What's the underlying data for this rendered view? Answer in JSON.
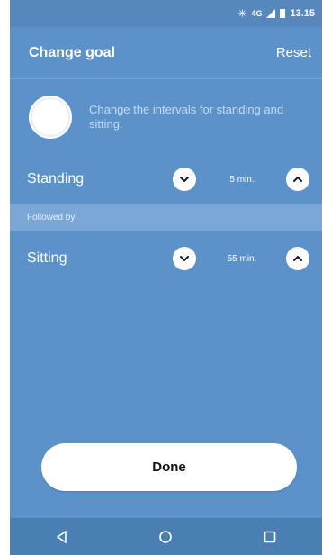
{
  "status_bar": {
    "bluetooth_icon": "bluetooth-icon",
    "network": "4G",
    "time": "13.15"
  },
  "header": {
    "title": "Change goal",
    "reset_label": "Reset"
  },
  "intro": {
    "text": "Change the intervals for standing and sitting."
  },
  "standing": {
    "label": "Standing",
    "value": "5 min."
  },
  "divider": {
    "label": "Followed by"
  },
  "sitting": {
    "label": "Sitting",
    "value": "55 min."
  },
  "done_label": "Done",
  "nav": {
    "back_icon": "back-triangle-icon",
    "home_icon": "home-circle-icon",
    "recents_icon": "recents-square-icon"
  },
  "colors": {
    "background": "#5b92c9",
    "divider_band": "#7aa7d6",
    "nav_bar": "#4a7fb3"
  }
}
